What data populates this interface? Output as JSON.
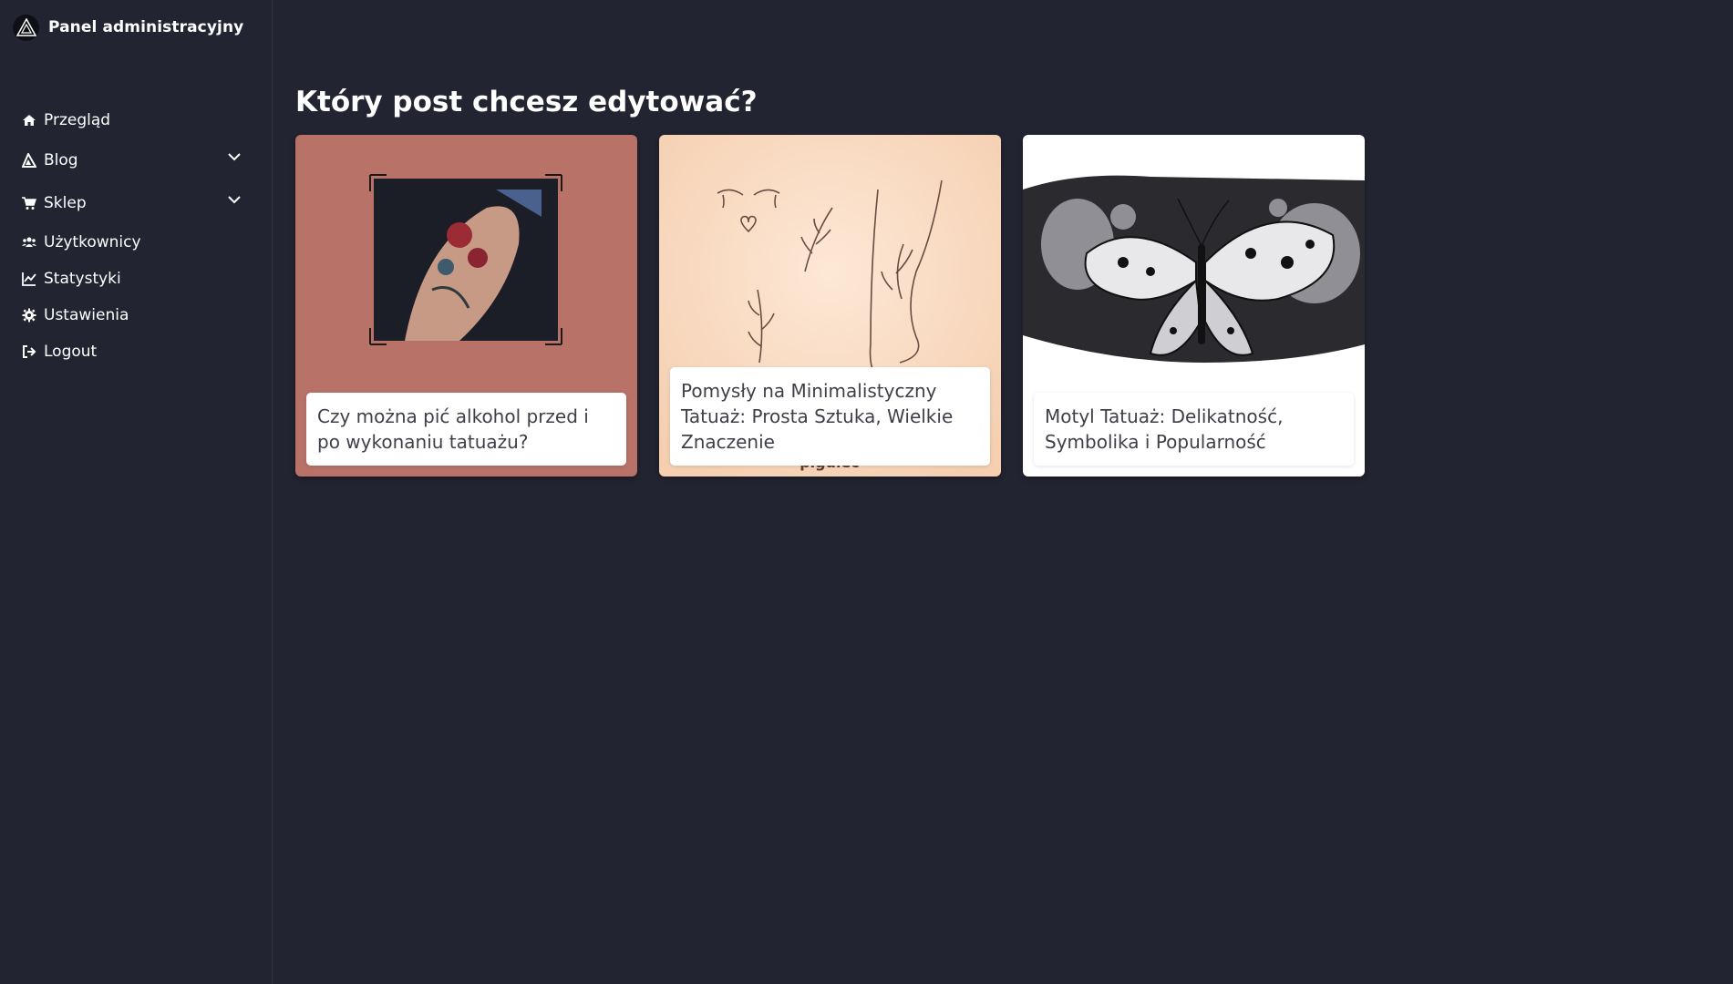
{
  "app": {
    "title": "Panel administracyjny"
  },
  "sidebar": {
    "items": [
      {
        "label": "Przegląd",
        "icon": "home-icon"
      },
      {
        "label": "Blog",
        "icon": "blog-icon",
        "expandable": true
      },
      {
        "label": "Sklep",
        "icon": "cart-icon",
        "expandable": true
      },
      {
        "label": "Użytkownicy",
        "icon": "users-icon"
      },
      {
        "label": "Statystyki",
        "icon": "chart-line-icon"
      },
      {
        "label": "Ustawienia",
        "icon": "gear-icon"
      },
      {
        "label": "Logout",
        "icon": "logout-icon"
      }
    ]
  },
  "main": {
    "title": "Który post chcesz edytować?",
    "posts": [
      {
        "title": "Czy można pić alkohol przed i po wykonaniu tatuażu?",
        "bg": "#b87268"
      },
      {
        "title": "Pomysły na Minimalistyczny Tatuaż: Prosta Sztuka, Wielkie Znaczenie",
        "bg": "#f9dcc4"
      },
      {
        "title": "Motyl Tatuaż: Delikatność, Symbolika i Popularność",
        "bg": "#ffffff"
      }
    ]
  }
}
